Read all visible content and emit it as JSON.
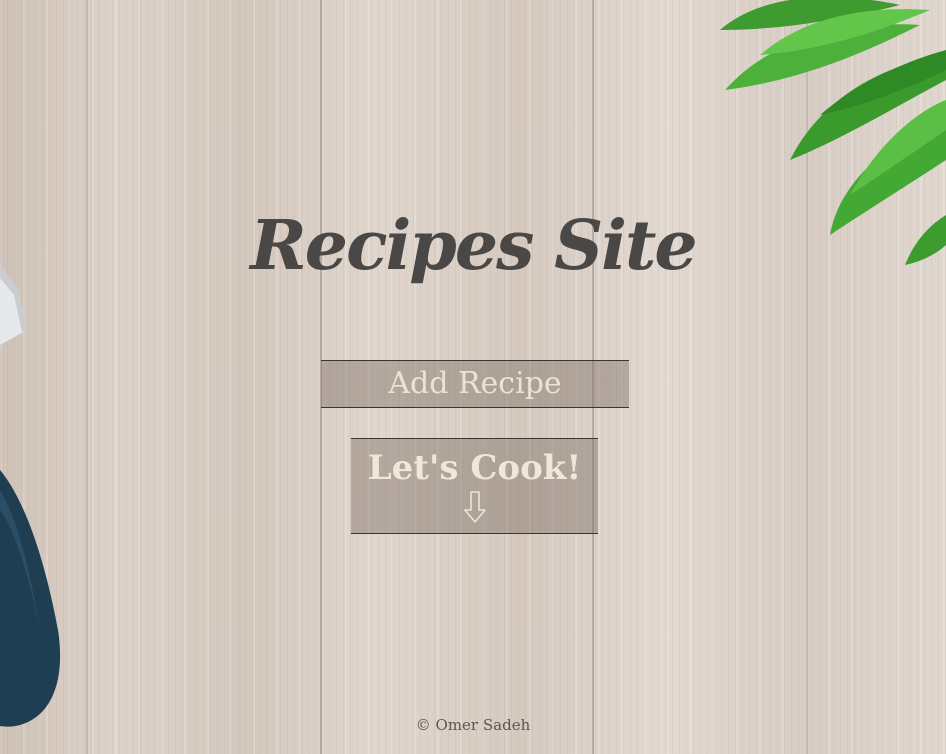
{
  "site": {
    "title": "Recipes Site"
  },
  "buttons": {
    "add_recipe": "Add Recipe",
    "lets_cook": "Let's Cook!",
    "lets_cook_icon": "down-arrow-icon"
  },
  "footer": {
    "text": "© Omer Sadeh"
  },
  "colors": {
    "title": "#4a4846",
    "button_text": "#ece3d5",
    "button_bg": "rgba(120,105,95,0.42)",
    "leaves": "#3fa535",
    "knife_handle": "#1f3e52"
  }
}
